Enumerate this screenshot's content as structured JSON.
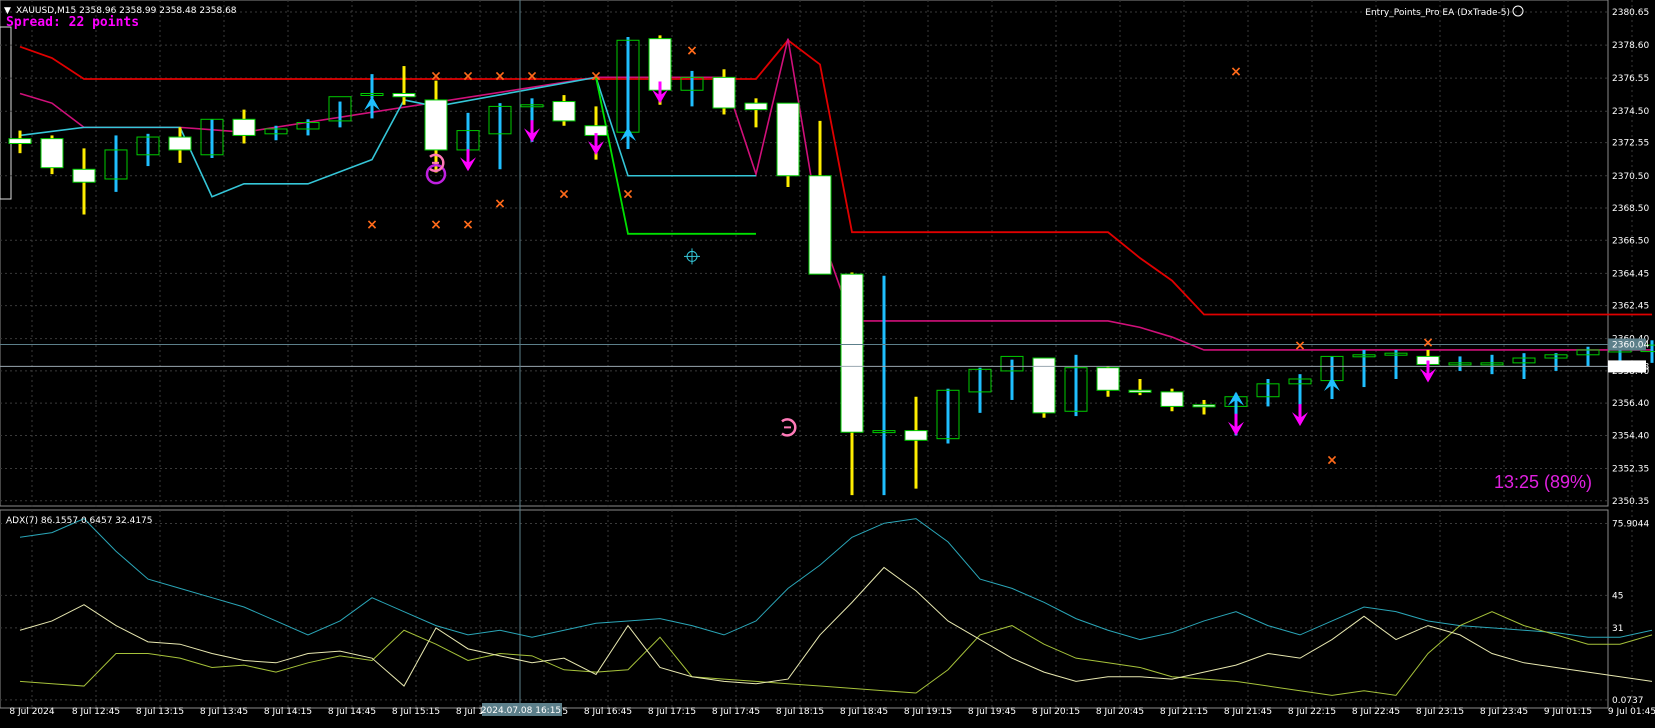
{
  "header": {
    "symbol_line": "XAUUSD,M15  2358.96 2358.99 2358.48 2358.68",
    "spread": "Spread: 22 points",
    "ea_label": "Entry_Points_Pro EA (DxTrade-5)",
    "countdown": "13:25 (89%)"
  },
  "colors": {
    "bull_body": "#ffffff",
    "bull_edge": "#00cc00",
    "wick_up": "#1fbfff",
    "wick_down": "#ffee00",
    "upper_line": "#e00000",
    "mid_line": "#d0107a",
    "lower_line": "#35c6d8",
    "green_line": "#00e000",
    "marker_x": "#ff6a1a",
    "arrow_magenta": "#ff00ff",
    "arrow_cyan": "#1fbfff",
    "grid": "#3a3a3a",
    "crosshair": "#5c7f8a",
    "adx_line": "#2aa6b8",
    "di_plus": "#a6c23a",
    "di_minus": "#e8e8b0"
  },
  "chart_data": [
    {
      "type": "candlestick",
      "title": "XAUUSD,M15",
      "y_ticks": [
        "2380.65",
        "2378.60",
        "2376.55",
        "2374.50",
        "2372.55",
        "2370.50",
        "2368.50",
        "2366.50",
        "2364.45",
        "2362.45",
        "2360.40",
        "2358.40",
        "2356.40",
        "2354.40",
        "2352.35",
        "2350.35"
      ],
      "ylim": [
        2350.15,
        2380.9
      ],
      "price_labels": {
        "current": "2358.68",
        "line": "2360.04"
      },
      "current_price": 2358.68,
      "line_price": 2360.04,
      "x_ticks": [
        "8 Jul 2024",
        "8 Jul 12:45",
        "8 Jul 13:15",
        "8 Jul 13:45",
        "8 Jul 14:15",
        "8 Jul 14:45",
        "8 Jul 15:15",
        "8 Jul 15:45",
        "8 Jul 16:15",
        "8 Jul 16:45",
        "8 Jul 17:15",
        "8 Jul 17:45",
        "8 Jul 18:15",
        "8 Jul 18:45",
        "8 Jul 19:15",
        "8 Jul 19:45",
        "8 Jul 20:15",
        "8 Jul 20:45",
        "8 Jul 21:15",
        "8 Jul 21:45",
        "8 Jul 22:15",
        "8 Jul 22:45",
        "8 Jul 23:15",
        "8 Jul 23:45",
        "9 Jul 01:15",
        "9 Jul 01:45"
      ],
      "crosshair_time": "2024.07.08 16:15",
      "candles": [
        {
          "o": 2372.8,
          "h": 2373.3,
          "l": 2371.9,
          "c": 2372.5
        },
        {
          "o": 2372.8,
          "h": 2373.0,
          "l": 2370.6,
          "c": 2371.0
        },
        {
          "o": 2370.9,
          "h": 2372.2,
          "l": 2368.1,
          "c": 2370.1
        },
        {
          "o": 2370.3,
          "h": 2373.0,
          "l": 2369.5,
          "c": 2372.1
        },
        {
          "o": 2371.8,
          "h": 2373.1,
          "l": 2371.1,
          "c": 2372.9
        },
        {
          "o": 2372.9,
          "h": 2373.5,
          "l": 2371.3,
          "c": 2372.1
        },
        {
          "o": 2371.8,
          "h": 2374.0,
          "l": 2371.6,
          "c": 2374.0
        },
        {
          "o": 2374.0,
          "h": 2374.6,
          "l": 2372.5,
          "c": 2373.0
        },
        {
          "o": 2373.1,
          "h": 2373.6,
          "l": 2372.7,
          "c": 2373.4
        },
        {
          "o": 2373.4,
          "h": 2374.0,
          "l": 2373.0,
          "c": 2373.8
        },
        {
          "o": 2373.9,
          "h": 2375.1,
          "l": 2373.5,
          "c": 2375.4
        },
        {
          "o": 2375.5,
          "h": 2376.8,
          "l": 2375.3,
          "c": 2375.6
        },
        {
          "o": 2375.6,
          "h": 2377.3,
          "l": 2374.9,
          "c": 2375.4
        },
        {
          "o": 2375.2,
          "h": 2376.4,
          "l": 2370.7,
          "c": 2372.1
        },
        {
          "o": 2372.1,
          "h": 2374.4,
          "l": 2371.2,
          "c": 2373.3
        },
        {
          "o": 2373.1,
          "h": 2375.0,
          "l": 2370.9,
          "c": 2374.8
        },
        {
          "o": 2374.8,
          "h": 2375.3,
          "l": 2372.6,
          "c": 2374.9
        },
        {
          "o": 2375.1,
          "h": 2375.5,
          "l": 2373.6,
          "c": 2373.9
        },
        {
          "o": 2373.6,
          "h": 2374.8,
          "l": 2371.5,
          "c": 2373.0
        },
        {
          "o": 2373.2,
          "h": 2379.1,
          "l": 2373.0,
          "c": 2378.9
        },
        {
          "o": 2379.0,
          "h": 2379.2,
          "l": 2374.9,
          "c": 2375.8
        },
        {
          "o": 2375.8,
          "h": 2377.0,
          "l": 2374.8,
          "c": 2376.6
        },
        {
          "o": 2376.6,
          "h": 2377.1,
          "l": 2374.3,
          "c": 2374.7
        },
        {
          "o": 2375.0,
          "h": 2375.3,
          "l": 2373.5,
          "c": 2374.6
        },
        {
          "o": 2375.0,
          "h": 2375.0,
          "l": 2369.8,
          "c": 2370.5
        },
        {
          "o": 2370.5,
          "h": 2373.9,
          "l": 2364.5,
          "c": 2364.4
        },
        {
          "o": 2364.4,
          "h": 2364.5,
          "l": 2350.7,
          "c": 2354.6
        },
        {
          "o": 2354.6,
          "h": 2364.3,
          "l": 2350.7,
          "c": 2354.7
        },
        {
          "o": 2354.7,
          "h": 2356.8,
          "l": 2351.1,
          "c": 2354.1
        },
        {
          "o": 2354.2,
          "h": 2357.3,
          "l": 2353.9,
          "c": 2357.2
        },
        {
          "o": 2357.1,
          "h": 2358.6,
          "l": 2355.8,
          "c": 2358.5
        },
        {
          "o": 2358.4,
          "h": 2359.1,
          "l": 2356.6,
          "c": 2359.3
        },
        {
          "o": 2359.2,
          "h": 2359.2,
          "l": 2355.5,
          "c": 2355.8
        },
        {
          "o": 2355.9,
          "h": 2359.4,
          "l": 2355.6,
          "c": 2358.6
        },
        {
          "o": 2358.6,
          "h": 2358.7,
          "l": 2356.8,
          "c": 2357.2
        },
        {
          "o": 2357.2,
          "h": 2357.9,
          "l": 2356.9,
          "c": 2357.1
        },
        {
          "o": 2357.1,
          "h": 2357.3,
          "l": 2355.9,
          "c": 2356.2
        },
        {
          "o": 2356.3,
          "h": 2356.6,
          "l": 2355.7,
          "c": 2356.2
        },
        {
          "o": 2356.2,
          "h": 2357.0,
          "l": 2354.4,
          "c": 2356.8
        },
        {
          "o": 2356.8,
          "h": 2357.9,
          "l": 2356.2,
          "c": 2357.6
        },
        {
          "o": 2357.6,
          "h": 2358.2,
          "l": 2356.0,
          "c": 2357.9
        },
        {
          "o": 2357.8,
          "h": 2359.3,
          "l": 2357.5,
          "c": 2359.3
        },
        {
          "o": 2359.3,
          "h": 2359.7,
          "l": 2357.4,
          "c": 2359.4
        },
        {
          "o": 2359.4,
          "h": 2359.7,
          "l": 2357.9,
          "c": 2359.5
        },
        {
          "o": 2359.3,
          "h": 2359.7,
          "l": 2358.2,
          "c": 2358.8
        },
        {
          "o": 2358.8,
          "h": 2359.3,
          "l": 2358.4,
          "c": 2358.9
        },
        {
          "o": 2358.9,
          "h": 2359.4,
          "l": 2358.2,
          "c": 2358.9
        },
        {
          "o": 2358.9,
          "h": 2359.5,
          "l": 2357.9,
          "c": 2359.2
        },
        {
          "o": 2359.2,
          "h": 2359.5,
          "l": 2358.4,
          "c": 2359.4
        },
        {
          "o": 2359.4,
          "h": 2359.9,
          "l": 2358.7,
          "c": 2359.7
        },
        {
          "o": 2359.7,
          "h": 2360.1,
          "l": 2358.9,
          "c": 2359.7
        },
        {
          "o": 2359.6,
          "h": 2360.3,
          "l": 2358.9,
          "c": 2360.0
        }
      ],
      "lines": {
        "upper": [
          [
            0,
            2378.5
          ],
          [
            1,
            2377.8
          ],
          [
            2,
            2376.5
          ],
          [
            3,
            2376.5
          ],
          [
            17,
            2376.5
          ],
          [
            18,
            2376.5
          ],
          [
            22,
            2376.5
          ],
          [
            23,
            2376.5
          ],
          [
            24,
            2378.9
          ],
          [
            25,
            2377.4
          ],
          [
            26,
            2367.0
          ],
          [
            34,
            2367.0
          ],
          [
            35,
            2365.4
          ],
          [
            36,
            2364.0
          ],
          [
            37,
            2361.9
          ],
          [
            51,
            2361.9
          ]
        ],
        "mid": [
          [
            0,
            2375.6
          ],
          [
            1,
            2375.0
          ],
          [
            2,
            2373.5
          ],
          [
            5,
            2373.5
          ],
          [
            7,
            2373.2
          ],
          [
            18,
            2376.6
          ],
          [
            22,
            2376.6
          ],
          [
            23,
            2370.6
          ],
          [
            24,
            2379.0
          ],
          [
            25,
            2367.1
          ],
          [
            26,
            2361.5
          ],
          [
            34,
            2361.5
          ],
          [
            35,
            2361.1
          ],
          [
            36,
            2360.5
          ],
          [
            37,
            2359.7
          ],
          [
            51,
            2359.7
          ]
        ],
        "lower": [
          [
            0,
            2373.0
          ],
          [
            2,
            2373.5
          ],
          [
            5,
            2373.5
          ],
          [
            6,
            2369.2
          ],
          [
            7,
            2370.0
          ],
          [
            9,
            2370.0
          ],
          [
            11,
            2371.5
          ],
          [
            12,
            2375.2
          ],
          [
            13,
            2374.8
          ],
          [
            18,
            2376.6
          ],
          [
            19,
            2370.5
          ],
          [
            23,
            2370.5
          ]
        ],
        "green": [
          [
            18,
            2376.6
          ],
          [
            19,
            2366.9
          ],
          [
            23,
            2366.9
          ]
        ]
      },
      "markers": [
        {
          "kind": "x",
          "i": 13,
          "p": 2376.7
        },
        {
          "kind": "x",
          "i": 14,
          "p": 2376.7
        },
        {
          "kind": "x",
          "i": 15,
          "p": 2376.7
        },
        {
          "kind": "x",
          "i": 16,
          "p": 2376.7
        },
        {
          "kind": "x",
          "i": 18,
          "p": 2376.7
        },
        {
          "kind": "x",
          "i": 21,
          "p": 2378.3
        },
        {
          "kind": "x",
          "i": 11,
          "p": 2367.5
        },
        {
          "kind": "x",
          "i": 13,
          "p": 2367.5
        },
        {
          "kind": "x",
          "i": 14,
          "p": 2367.5
        },
        {
          "kind": "x",
          "i": 15,
          "p": 2368.8
        },
        {
          "kind": "x",
          "i": 17,
          "p": 2369.4
        },
        {
          "kind": "x",
          "i": 19,
          "p": 2369.4
        },
        {
          "kind": "x",
          "i": 38,
          "p": 2377.0
        },
        {
          "kind": "x",
          "i": 40,
          "p": 2360.0
        },
        {
          "kind": "x",
          "i": 41,
          "p": 2352.9
        },
        {
          "kind": "x",
          "i": 44,
          "p": 2360.2
        },
        {
          "kind": "arrow_up",
          "i": 11,
          "p": 2374.8
        },
        {
          "kind": "arrow_up",
          "i": 19,
          "p": 2372.9
        },
        {
          "kind": "arrow_up",
          "i": 38,
          "p": 2356.5
        },
        {
          "kind": "arrow_up",
          "i": 41,
          "p": 2357.4
        },
        {
          "kind": "arrow_down",
          "i": 14,
          "p": 2371.4
        },
        {
          "kind": "arrow_down",
          "i": 16,
          "p": 2373.2
        },
        {
          "kind": "arrow_down",
          "i": 18,
          "p": 2372.4
        },
        {
          "kind": "arrow_down",
          "i": 20,
          "p": 2375.6
        },
        {
          "kind": "arrow_down",
          "i": 38,
          "p": 2355.0
        },
        {
          "kind": "arrow_down",
          "i": 40,
          "p": 2355.6
        },
        {
          "kind": "arrow_down",
          "i": 44,
          "p": 2358.3
        },
        {
          "kind": "circle",
          "i": 13,
          "p": 2370.6
        },
        {
          "kind": "target",
          "i": 21,
          "p": 2365.5
        },
        {
          "kind": "hook",
          "i": 24,
          "p": 2354.9
        },
        {
          "kind": "hook",
          "i": 13,
          "p": 2371.3
        }
      ]
    },
    {
      "type": "line",
      "title": "ADX(7) 86.1557 0.6457 32.4175",
      "y_ticks": [
        "75.9044",
        "45",
        "31",
        "0.0737"
      ],
      "ylim": [
        0,
        80
      ],
      "series": [
        {
          "values": [
            70,
            72,
            78,
            64,
            52,
            48,
            44,
            40,
            34,
            28,
            34,
            44,
            38,
            32,
            28,
            30,
            27,
            30,
            33,
            34,
            35,
            32,
            28,
            34,
            48,
            58,
            70,
            76,
            78,
            68,
            52,
            48,
            42,
            35,
            30,
            26,
            29,
            34,
            38,
            32,
            28,
            34,
            40,
            38,
            34,
            32,
            31,
            30,
            29,
            27,
            27,
            30
          ]
        },
        {
          "values": [
            8,
            7,
            6,
            20,
            20,
            18,
            14,
            15,
            12,
            16,
            19,
            17,
            30,
            24,
            17,
            20,
            19,
            13,
            12,
            13,
            27,
            10,
            9,
            8,
            7,
            6,
            5,
            4,
            3,
            13,
            28,
            32,
            24,
            18,
            16,
            14,
            10,
            9,
            8,
            6,
            4,
            2,
            4,
            2,
            20,
            32,
            38,
            32,
            28,
            24,
            24,
            28
          ]
        },
        {
          "values": [
            30,
            34,
            41,
            32,
            25,
            24,
            20,
            17,
            16,
            20,
            21,
            18,
            6,
            31,
            22,
            19,
            16,
            18,
            11,
            32,
            14,
            10,
            8,
            7,
            9,
            28,
            42,
            57,
            47,
            34,
            26,
            18,
            12,
            8,
            10,
            10,
            9,
            12,
            15,
            20,
            18,
            26,
            36,
            26,
            32,
            28,
            20,
            16,
            14,
            12,
            10,
            8
          ]
        }
      ]
    }
  ]
}
